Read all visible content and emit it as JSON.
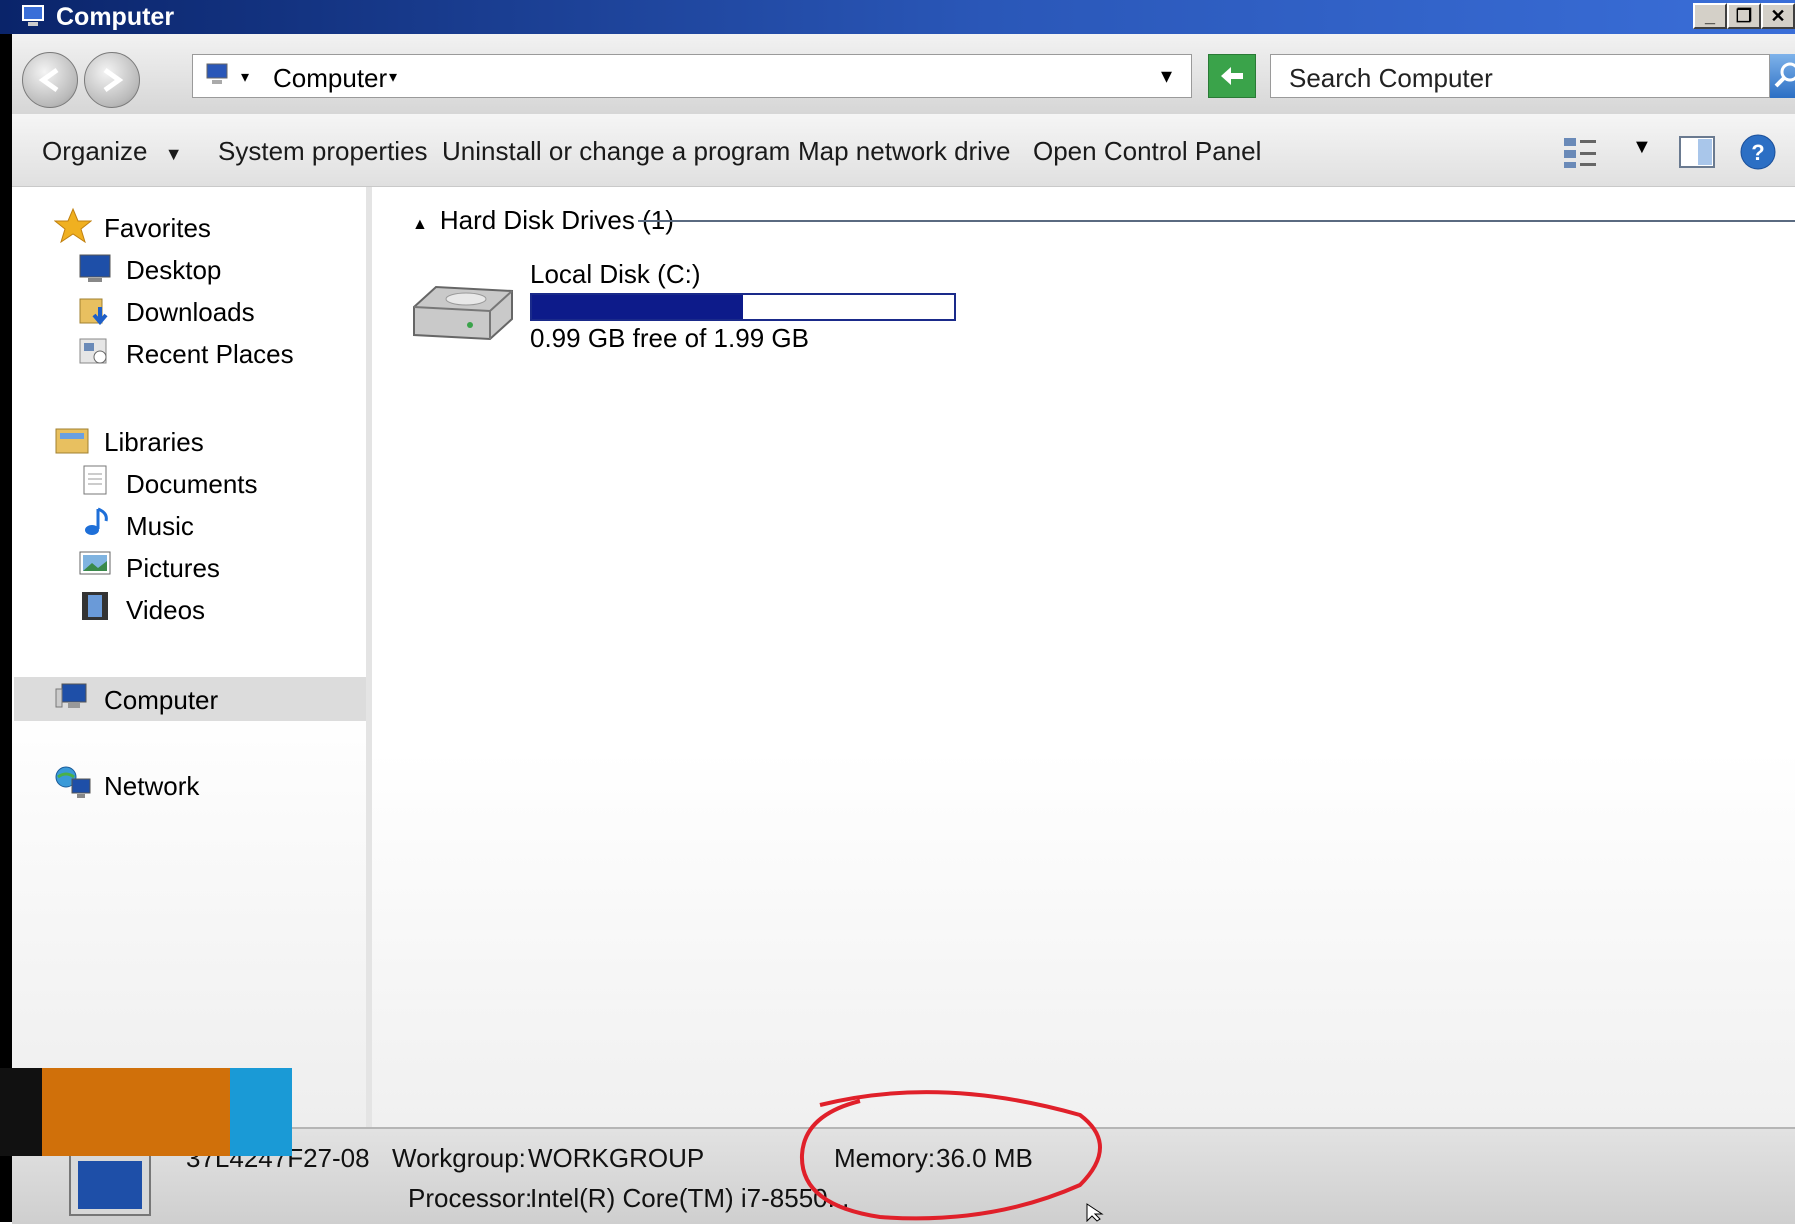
{
  "window": {
    "title": "Computer"
  },
  "address": {
    "location": "Computer"
  },
  "search": {
    "placeholder": "Search Computer"
  },
  "toolbar": {
    "organize": "Organize",
    "system_properties": "System properties",
    "uninstall": "Uninstall or change a program",
    "map_drive": "Map network drive",
    "control_panel": "Open Control Panel"
  },
  "nav": {
    "favorites": "Favorites",
    "desktop": "Desktop",
    "downloads": "Downloads",
    "recent": "Recent Places",
    "libraries": "Libraries",
    "documents": "Documents",
    "music": "Music",
    "pictures": "Pictures",
    "videos": "Videos",
    "computer": "Computer",
    "network": "Network"
  },
  "content": {
    "group_header": "Hard Disk Drives (1)",
    "drive": {
      "name": "Local Disk (C:)",
      "free_text": "0.99 GB free of 1.99 GB",
      "used_fraction": 0.5
    }
  },
  "details": {
    "computer_name": "37L4247F27-08",
    "workgroup_label": "Workgroup:",
    "workgroup": "WORKGROUP",
    "memory_label": "Memory:",
    "memory": "36.0 MB",
    "processor_label": "Processor:",
    "processor": "Intel(R) Core(TM) i7-8550..."
  },
  "colors": {
    "title_bar": "#0a246a",
    "drive_fill": "#0d1b8a",
    "annotation": "#e0202a",
    "overlay_orange": "#d0700a",
    "overlay_blue": "#1a9ad6"
  }
}
